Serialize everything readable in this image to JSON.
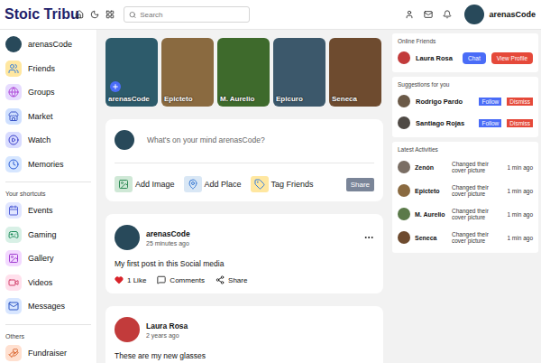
{
  "app": {
    "logo": "Stoic Tribu",
    "search_placeholder": "Search",
    "user": "arenasCode"
  },
  "sidebar": {
    "items": [
      "arenasCode",
      "Friends",
      "Groups",
      "Market",
      "Watch",
      "Memories"
    ],
    "shortcuts_title": "Your shortcuts",
    "shortcuts": [
      "Events",
      "Gaming",
      "Gallery",
      "Videos",
      "Messages"
    ],
    "others_title": "Others",
    "others": [
      "Fundraiser"
    ]
  },
  "stories": [
    {
      "name": "arenasCode",
      "own": true
    },
    {
      "name": "Epicteto",
      "own": false
    },
    {
      "name": "M. Aurelio",
      "own": false
    },
    {
      "name": "Epicuro",
      "own": false
    },
    {
      "name": "Seneca",
      "own": false
    }
  ],
  "composer": {
    "placeholder": "What's on your mind arenasCode?",
    "actions": [
      "Add Image",
      "Add Place",
      "Tag Friends"
    ],
    "submit": "Share"
  },
  "posts": [
    {
      "author": "arenasCode",
      "time": "25 minutes ago",
      "text": "My first post in this Social media",
      "likes": "1 Like",
      "liked": true,
      "comments": "Comments",
      "share": "Share"
    },
    {
      "author": "Laura Rosa",
      "time": "2 years ago",
      "text": "These are my new glasses"
    }
  ],
  "online": {
    "title": "Online Friends",
    "friends": [
      {
        "name": "Laura Rosa",
        "chat": "Chat",
        "profile": "View Profile"
      }
    ]
  },
  "suggestions": {
    "title": "Suggestions for you",
    "people": [
      {
        "name": "Rodrigo Pardo",
        "follow": "Follow",
        "dismiss": "Dismiss"
      },
      {
        "name": "Santiago Rojas",
        "follow": "Follow",
        "dismiss": "Dismiss"
      }
    ]
  },
  "activities": {
    "title": "Latest Activities",
    "items": [
      {
        "name": "Zenón",
        "text": "Changed their cover picture",
        "time": "1 min ago"
      },
      {
        "name": "Epicteto",
        "text": "Changed their cover picture",
        "time": "1 min ago"
      },
      {
        "name": "M. Aurelio",
        "text": "Changed their cover picture",
        "time": "1 min ago"
      },
      {
        "name": "Seneca",
        "text": "Changed their cover picture",
        "time": "1 min ago"
      }
    ]
  }
}
